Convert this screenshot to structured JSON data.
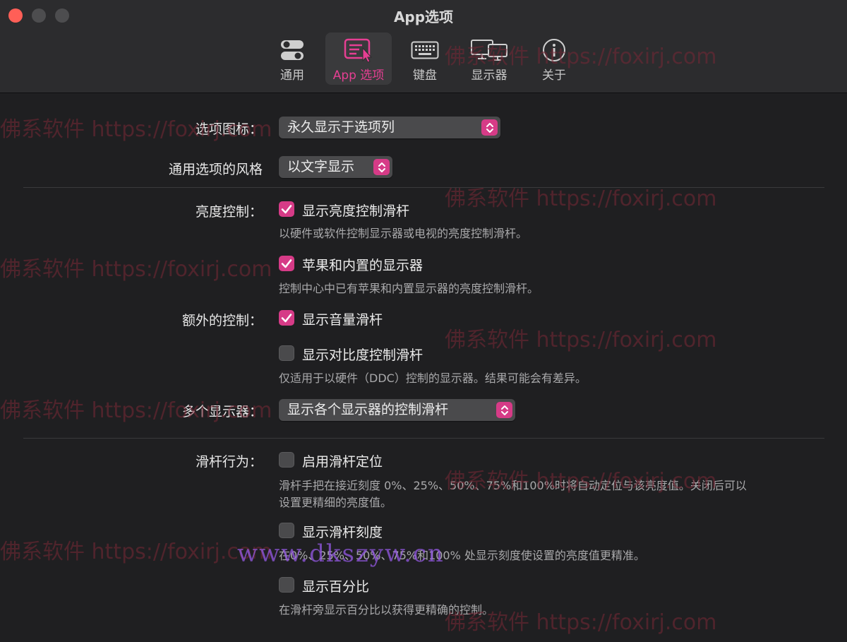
{
  "window": {
    "title": "App选项"
  },
  "tabs": [
    {
      "label": "通用",
      "icon": "toggle-icon"
    },
    {
      "label": "App 选项",
      "icon": "app-menu-icon"
    },
    {
      "label": "键盘",
      "icon": "keyboard-icon"
    },
    {
      "label": "显示器",
      "icon": "displays-icon"
    },
    {
      "label": "关于",
      "icon": "info-icon"
    }
  ],
  "active_tab": 1,
  "accent_color": "#d63b87",
  "settings": {
    "option_icon": {
      "label": "选项图标：",
      "value": "永久显示于选项列"
    },
    "option_style": {
      "label": "通用选项的风格",
      "value": "以文字显示"
    },
    "brightness": {
      "label": "亮度控制：",
      "slider": {
        "label": "显示亮度控制滑杆",
        "checked": true,
        "desc": "以硬件或软件控制显示器或电视的亮度控制滑杆。"
      },
      "apple": {
        "label": "苹果和内置的显示器",
        "checked": true,
        "desc": "控制中心中已有苹果和内置显示器的亮度控制滑杆。"
      }
    },
    "extra": {
      "label": "额外的控制：",
      "volume": {
        "label": "显示音量滑杆",
        "checked": true
      },
      "contrast": {
        "label": "显示对比度控制滑杆",
        "checked": false,
        "desc": "仅适用于以硬件（DDC）控制的显示器。结果可能会有差异。"
      }
    },
    "multi": {
      "label": "多个显示器：",
      "value": "显示各个显示器的控制滑杆"
    },
    "slider_behavior": {
      "label": "滑杆行为：",
      "snap": {
        "label": "启用滑杆定位",
        "checked": false,
        "desc1": "滑杆手把在接近刻度 0%、25%、50%、75%和100%时将自动定位与该亮度值。关闭后可以",
        "desc2": "设置更精细的亮度值。"
      },
      "ticks": {
        "label": "显示滑杆刻度",
        "checked": false,
        "desc": "在0%、25%、50%、75%和100% 处显示刻度使设置的亮度值更精准。"
      },
      "percent": {
        "label": "显示百分比",
        "checked": false,
        "desc": "在滑杆旁显示百分比以获得更精确的控制。"
      }
    }
  },
  "watermarks": {
    "text": "佛系软件 https://foxirj.com",
    "url": "www.dkszyw.cn"
  }
}
